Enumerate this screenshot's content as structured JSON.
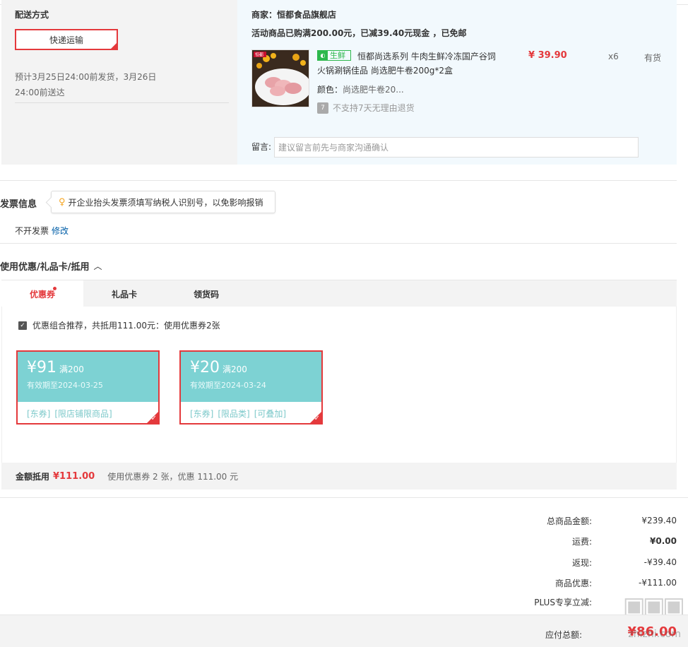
{
  "shipping": {
    "section_label": "配送方式",
    "method_label": "快递运输",
    "eta_line1": "预计3月25日24:00前发货，3月26日",
    "eta_line2": "24:00前送达"
  },
  "order": {
    "merchant_label": "商家：恒都食品旗舰店",
    "promo_text": "活动商品已购满200.00元，已减39.40元现金 ，已免邮",
    "product": {
      "thumb_label": "恒都",
      "tag_label": "生鲜",
      "name": "恒都尚选系列 牛肉生鲜冷冻国产谷饲火锅涮锅佳品 尚选肥牛卷200g*2盒",
      "price": "¥ 39.90",
      "qty": "x6",
      "stock": "有货",
      "color_key": "颜色：",
      "color_value": "尚选肥牛卷20...",
      "return_icon": "7",
      "return_note": "不支持7天无理由退货"
    },
    "message_label": "留言:",
    "message_placeholder": "建议留言前先与商家沟通确认"
  },
  "invoice": {
    "title": "发票信息",
    "tip": "开企业抬头发票须填写纳税人识别号，以免影响报销",
    "status": "不开发票",
    "edit_link": "修改"
  },
  "coupon": {
    "title": "使用优惠/礼品卡/抵用",
    "tabs": [
      "优惠券",
      "礼品卡",
      "领货码"
    ],
    "combo_text": "优惠组合推荐，共抵用111.00元：使用优惠券2张",
    "cards": [
      {
        "amount": "¥91",
        "condition": "满200",
        "expiry": "有效期至2024-03-25",
        "tags": [
          "[东券]",
          "[限店铺限商品]"
        ]
      },
      {
        "amount": "¥20",
        "condition": "满200",
        "expiry": "有效期至2024-03-24",
        "tags": [
          "[东券]",
          "[限品类]",
          "[可叠加]"
        ]
      }
    ],
    "footer_key": "金额抵用",
    "footer_value": "¥111.00",
    "footer_desc": "使用优惠券 2 张，优惠 111.00 元"
  },
  "totals": {
    "rows": [
      {
        "label": "总商品金额:",
        "value": "¥239.40",
        "bold": false
      },
      {
        "label": "运费:",
        "value": "¥0.00",
        "bold": true
      },
      {
        "label": "返现:",
        "value": "-¥39.40",
        "bold": false
      },
      {
        "label": "商品优惠:",
        "value": "-¥111.00",
        "bold": false
      },
      {
        "label": "PLUS专享立减:",
        "value": "",
        "bold": false
      }
    ],
    "pay_label": "应付总额:",
    "pay_value": "¥86.00",
    "watermark_text": "zhizhi.com"
  },
  "colors": {
    "accent": "#e4393c",
    "coupon_bg": "#7dd2d3",
    "fresh_green": "#2db84d",
    "link": "#005ea7"
  }
}
